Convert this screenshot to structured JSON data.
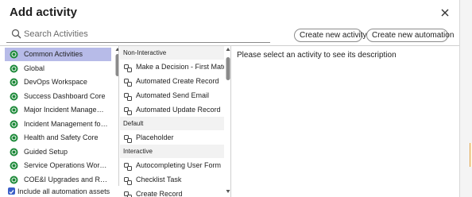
{
  "dialog": {
    "title": "Add activity",
    "search_placeholder": "Search Activities",
    "create_activity_label": "Create new activity",
    "create_automation_label": "Create new automation",
    "description_placeholder": "Please select an activity to see its description",
    "include_all_label": "Include all automation assets"
  },
  "categories": [
    {
      "label": "Common Activities",
      "selected": true
    },
    {
      "label": "Global",
      "selected": false
    },
    {
      "label": "DevOps Workspace",
      "selected": false
    },
    {
      "label": "Success Dashboard Core",
      "selected": false
    },
    {
      "label": "Major Incident Manageme…",
      "selected": false
    },
    {
      "label": "Incident Management for …",
      "selected": false
    },
    {
      "label": "Health and Safety Core",
      "selected": false
    },
    {
      "label": "Guided Setup",
      "selected": false
    },
    {
      "label": "Service Operations Works…",
      "selected": false
    },
    {
      "label": "COE&I Upgrades and Rele…",
      "selected": false
    }
  ],
  "activity_groups": [
    {
      "header": "Non-Interactive",
      "items": [
        "Make a Decision - First Match",
        "Automated Create Record",
        "Automated Send Email",
        "Automated Update Record"
      ]
    },
    {
      "header": "Default",
      "items": [
        "Placeholder"
      ]
    },
    {
      "header": "Interactive",
      "items": [
        "Autocompleting User Form",
        "Checklist Task",
        "Create Record"
      ]
    }
  ],
  "colors": {
    "selected_bg": "#b7bbe8",
    "icon_green": "#1e8a3a",
    "checkbox_blue": "#3a5ec8"
  },
  "icons": {
    "category": "green-circle-icon",
    "activity": "activity-flow-icon",
    "close": "close-icon",
    "search": "search-icon",
    "checkbox": "checkbox-checked-icon"
  }
}
